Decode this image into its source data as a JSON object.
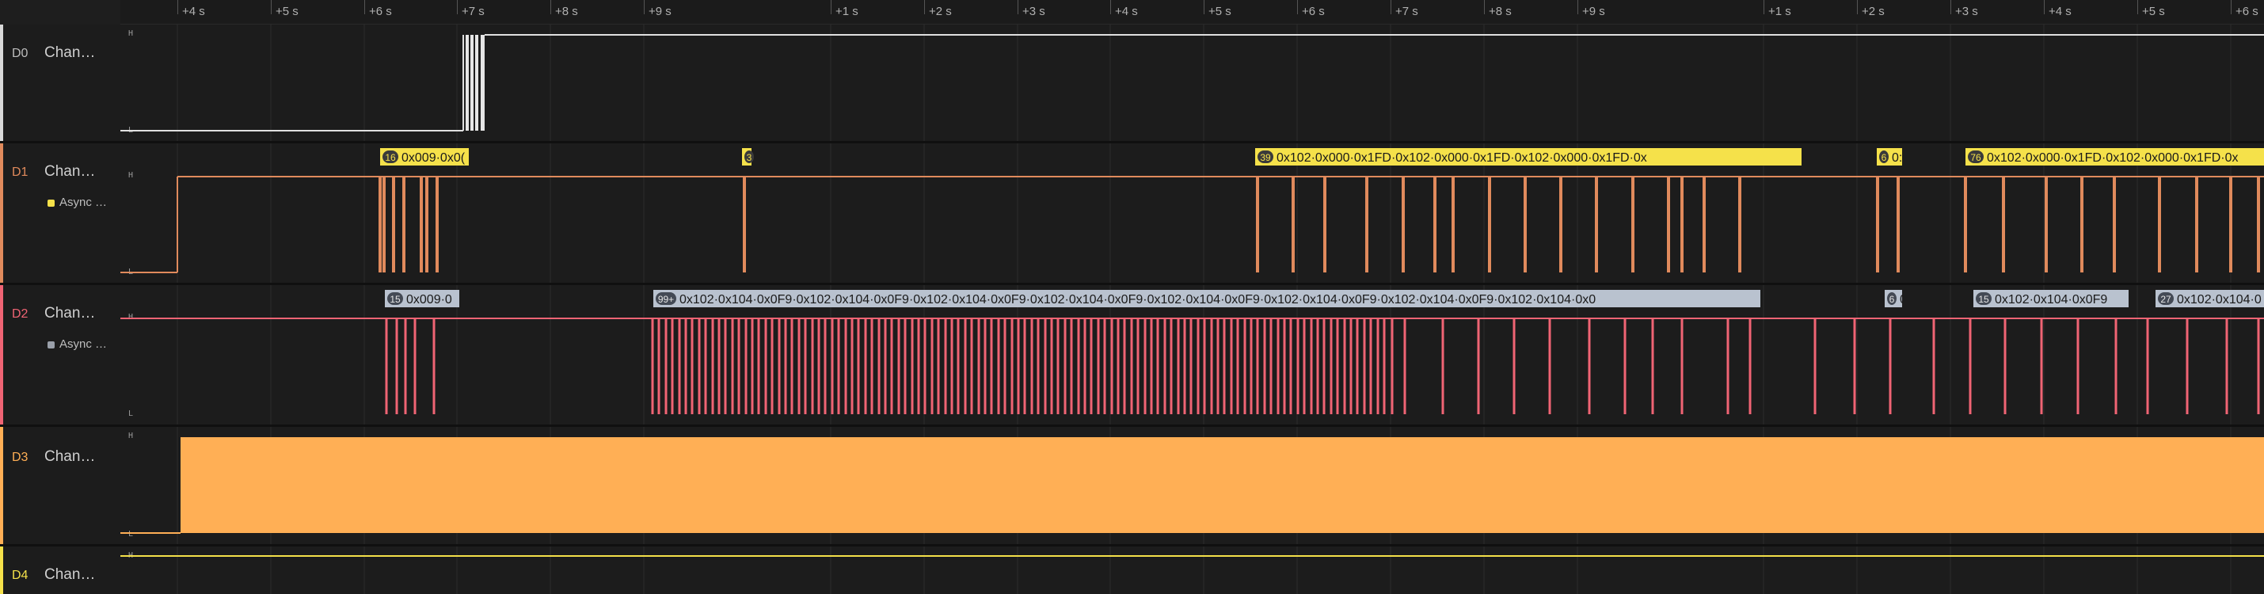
{
  "ruler": {
    "ticks": [
      "+4 s",
      "+5 s",
      "+6 s",
      "+7 s",
      "+8 s",
      "+9 s",
      "+1 s",
      "+2 s",
      "+3 s",
      "+4 s",
      "+5 s",
      "+6 s",
      "+7 s",
      "+8 s",
      "+9 s",
      "+1 s",
      "+2 s",
      "+3 s",
      "+4 s",
      "+5 s",
      "+6 s"
    ]
  },
  "levels": {
    "high": "H",
    "low": "L"
  },
  "channels": [
    {
      "id": "D0",
      "name": "Chan…",
      "color": "#e0e0e0"
    },
    {
      "id": "D1",
      "name": "Chan…",
      "color": "#e08a5c",
      "analyzer": "Async …",
      "analyzer_color": "#f5e14a"
    },
    {
      "id": "D2",
      "name": "Chan…",
      "color": "#f06474",
      "analyzer": "Async …",
      "analyzer_color": "#9aa0aa"
    },
    {
      "id": "D3",
      "name": "Chan…",
      "color": "#ffaf55"
    },
    {
      "id": "D4",
      "name": "Chan…",
      "color": "#f5e14a"
    }
  ],
  "d1_frames": [
    {
      "count": "16",
      "text": "0x009·0x0("
    },
    {
      "count": "3",
      "text": ""
    },
    {
      "count": "39",
      "text": "0x102·0x000·0x1FD·0x102·0x000·0x1FD·0x102·0x000·0x1FD·0x"
    },
    {
      "count": "6",
      "text": "0:"
    },
    {
      "count": "76",
      "text": "0x102·0x000·0x1FD·0x102·0x000·0x1FD·0x"
    }
  ],
  "d2_frames": [
    {
      "count": "15",
      "text": "0x009·0"
    },
    {
      "count": "99+",
      "text": "0x102·0x104·0x0F9·0x102·0x104·0x0F9·0x102·0x104·0x0F9·0x102·0x104·0x0F9·0x102·0x104·0x0F9·0x102·0x104·0x0F9·0x102·0x104·0x0F9·0x102·0x104·0x0"
    },
    {
      "count": "6",
      "text": "0:"
    },
    {
      "count": "15",
      "text": "0x102·0x104·0x0F9"
    },
    {
      "count": "27",
      "text": "0x102·0x104·0"
    }
  ]
}
